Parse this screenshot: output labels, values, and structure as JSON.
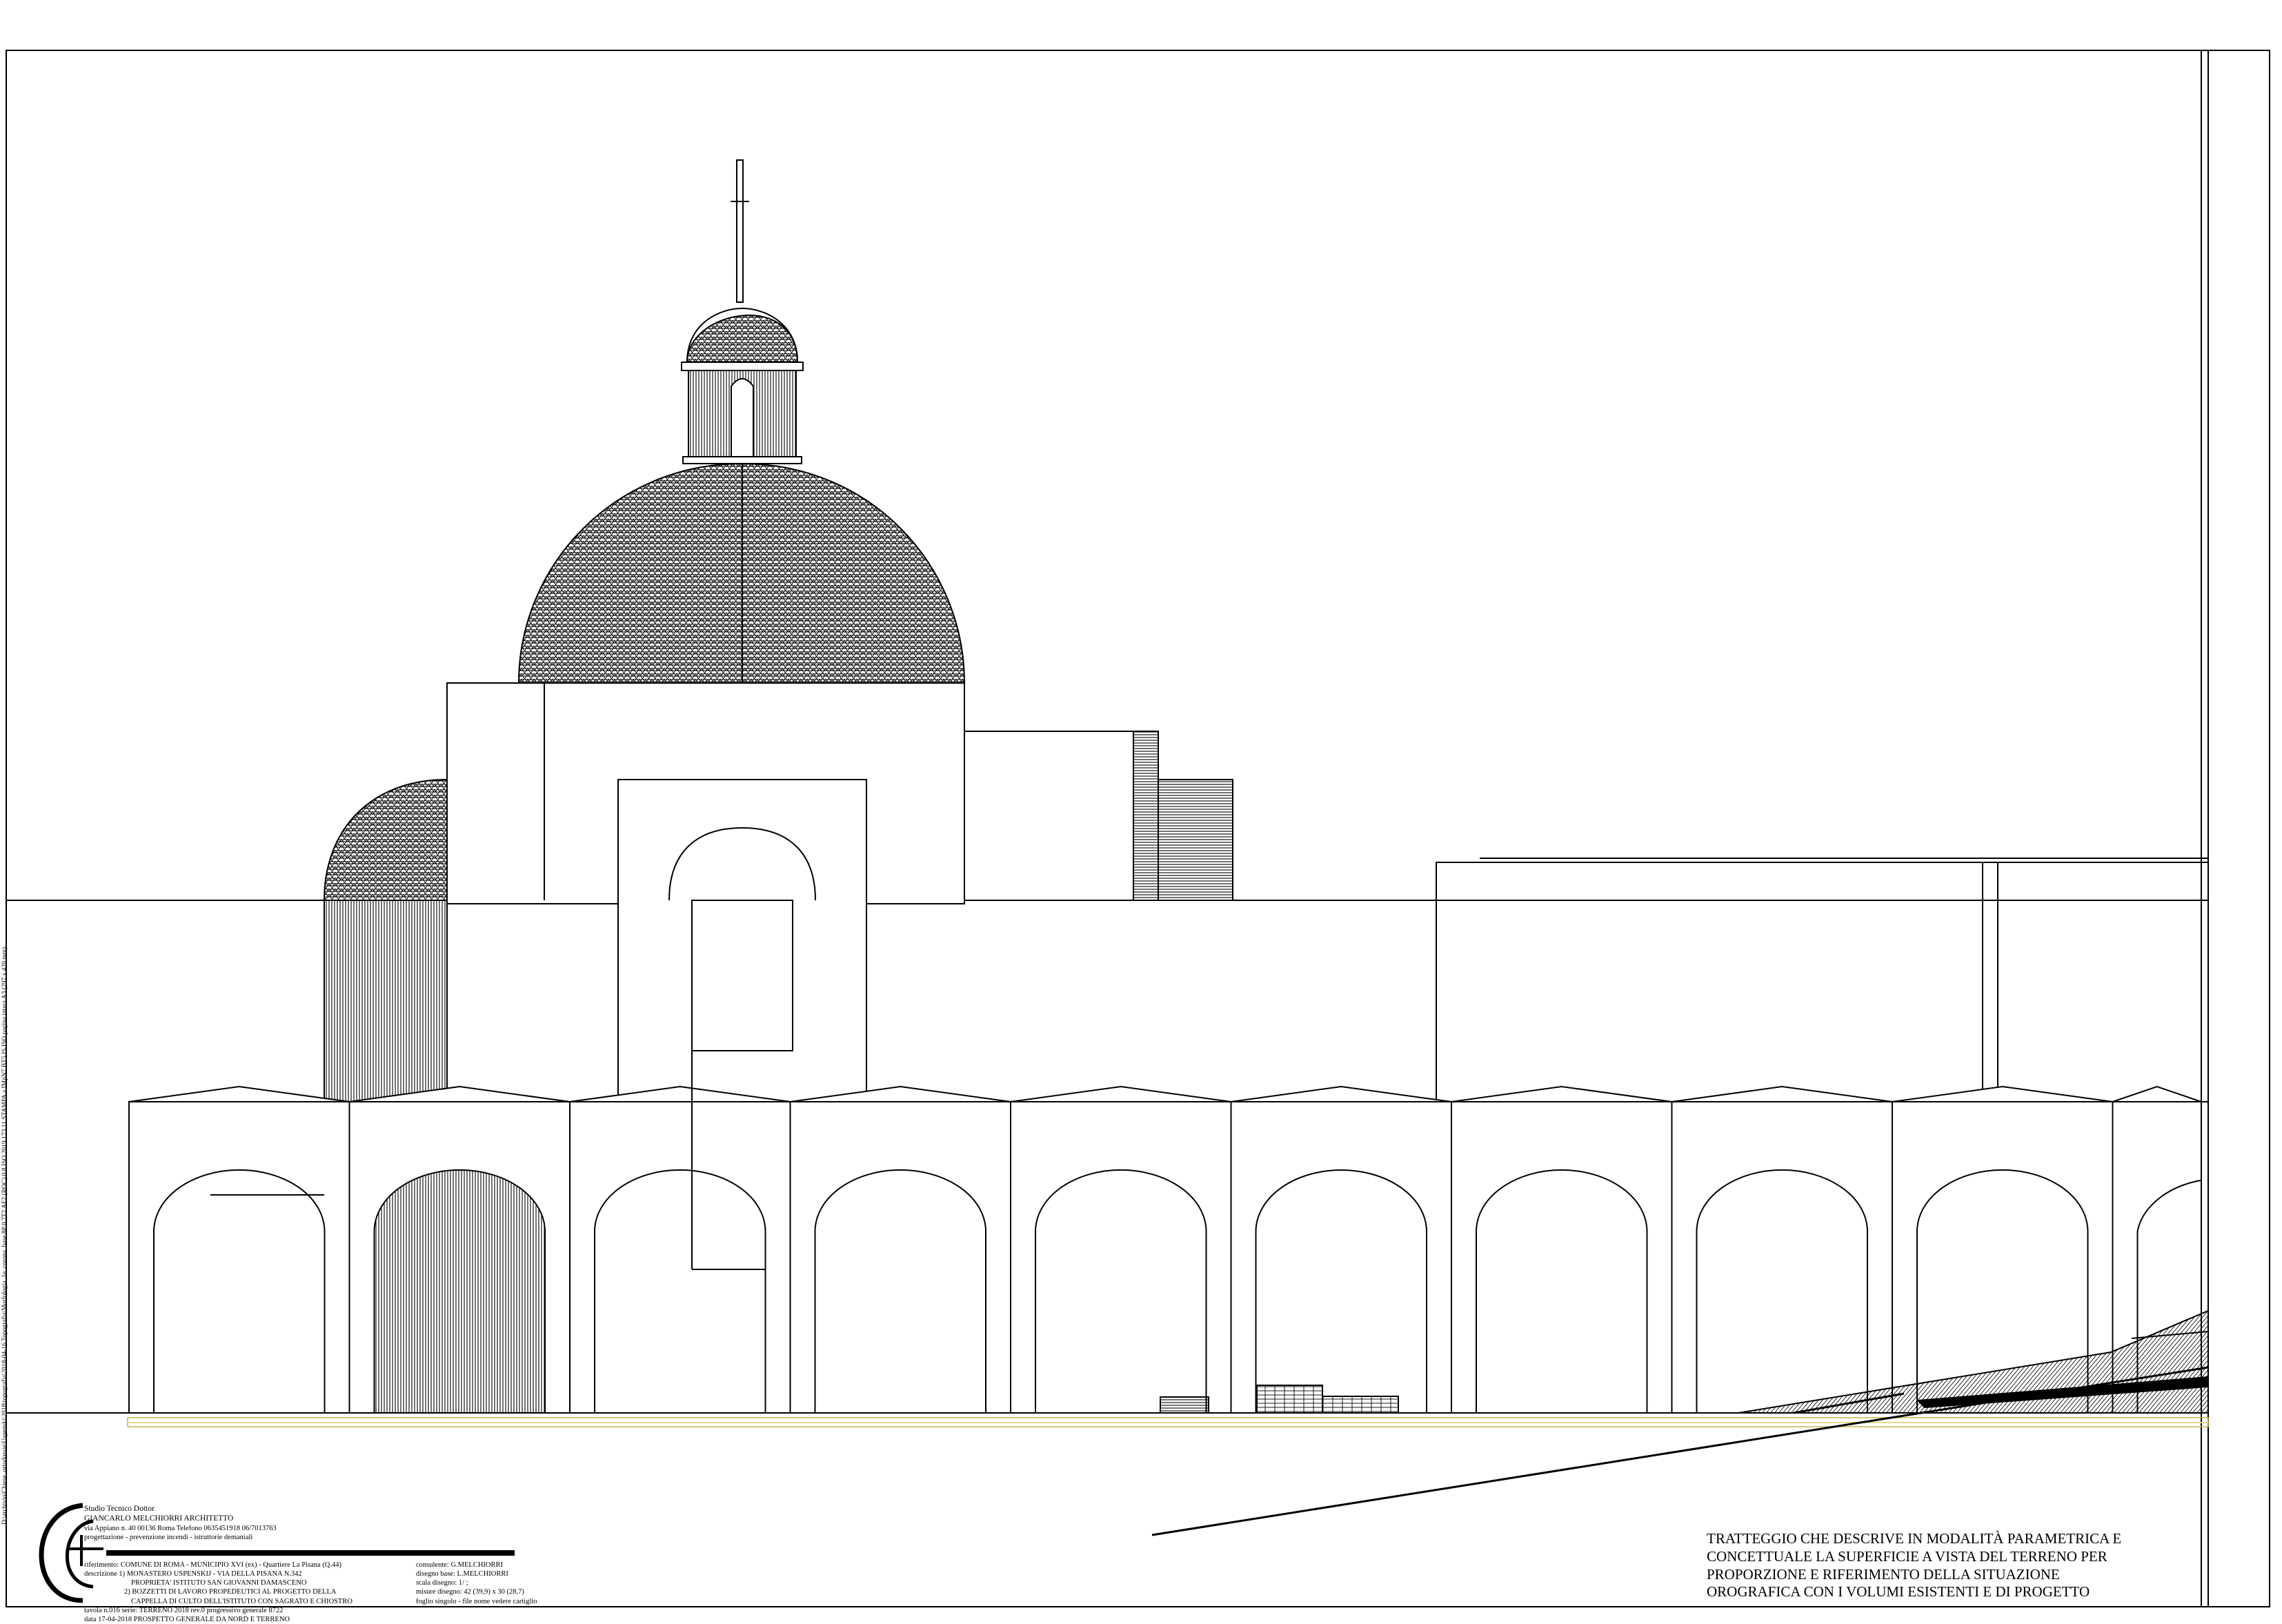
{
  "file_path": "D:\\archivio\\Chiese_ortodossie\\Uspenski\\2018\\topografia\\2018-04-16 Topografia\\Morfologia_1e_corona_base 8P 0,7T2 AF2 (ROC) 0,8 ISO 2019 173 11 STAMPA a  IMpN7 BT5 IS ISO pagina intera A3 (297 x 420 mm)",
  "studio": {
    "name": "Studio Tecnico Dottor",
    "architect": "GIANCARLO MELCHIORRI ARCHITETTO",
    "address": "via Appiano n. 40   00136 Roma   Telefono 0635451918 06/7013763",
    "services": "progettazione        -         prevenzione incendi        -         istruttorie demaniali"
  },
  "title_block": {
    "riferimento": "riferimento: COMUNE DI ROMA - MUNICIPIO XVI (ex)  - Quartiere La Pisana (Q.44)",
    "descrizione": "descrizione 1) MONASTERO USPENSKIJ - VIA DELLA PISANA N.342",
    "proprieta": "PROPRIETA' ISTITUTO SAN GIOVANNI DAMASCENO",
    "bozzetti_1": "2) BOZZETTI DI LAVORO PROPEDEUTICI AL PROGETTO DELLA",
    "bozzetti_2": "CAPPELLA DI CULTO DELL'ISTITUTO CON SAGRATO E CHIOSTRO",
    "tavola": "tavola n.016  serie: TERRENO 2018 rev.0        progressivo generale 8722",
    "data": "data 17-04-2018              PROSPETTO GENERALE DA NORD E TERRENO",
    "consulente": "consulente: G.MELCHIORRI",
    "disegno_base": "disegno base: L.MELCHIORRI",
    "scala": "scala disegno:  1/          ;",
    "misure": "misure disegno: 42 (39,9) x 30 (28,7)",
    "foglio": "foglio singolo - file nome vedere cartiglio"
  },
  "notes": [
    "TRATTEGGIO CHE DESCRIVE IN MODALITÀ PARAMETRICA E",
    "CONCETTUALE LA SUPERFICIE A VISTA DEL TERRENO PER",
    "PROPORZIONE E RIFERIMENTO DELLA SITUAZIONE",
    "OROGRAFICA CON I VOLUMI ESISTENTI E DI PROGETTO"
  ],
  "colors": {
    "line": "#000000",
    "ground_band": "#e6d88a",
    "background": "#ffffff"
  }
}
